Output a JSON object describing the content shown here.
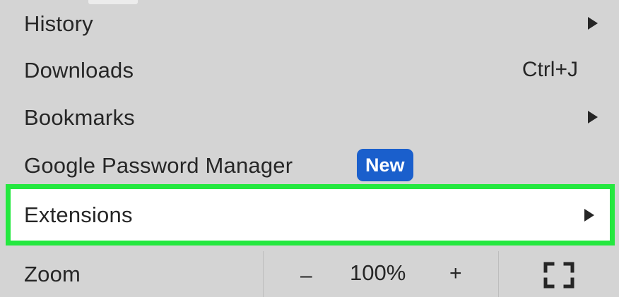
{
  "menu": {
    "items": [
      {
        "label": "History",
        "has_submenu": true
      },
      {
        "label": "Downloads",
        "shortcut": "Ctrl+J"
      },
      {
        "label": "Bookmarks",
        "has_submenu": true
      },
      {
        "label": "Google Password Manager",
        "badge": "New"
      },
      {
        "label": "Extensions",
        "has_submenu": true,
        "highlighted": true
      }
    ],
    "zoom": {
      "label": "Zoom",
      "decrease_label": "–",
      "value": "100%",
      "increase_label": "+",
      "fullscreen_icon": "fullscreen-icon"
    }
  },
  "colors": {
    "menu_background": "#d4d4d4",
    "highlight_border": "#24e83f",
    "highlight_background": "#ffffff",
    "badge_background": "#1a5fcc",
    "badge_text": "#ffffff",
    "text": "#262626"
  }
}
